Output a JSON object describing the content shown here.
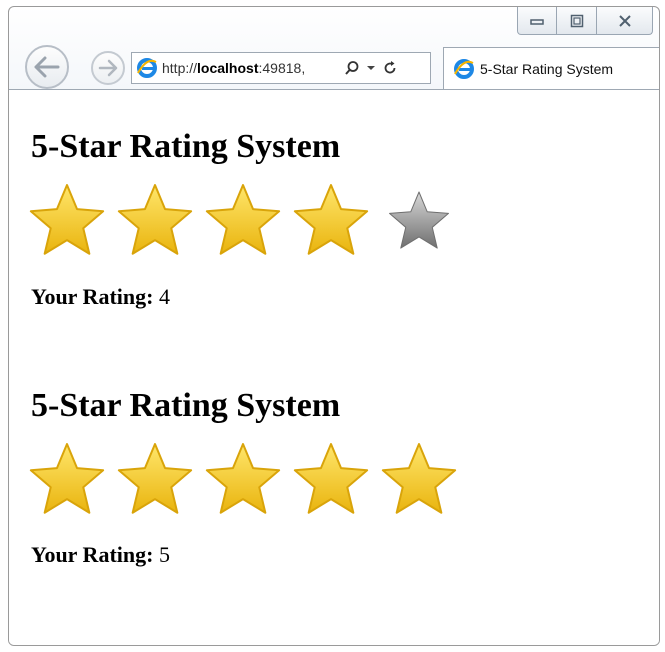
{
  "browser": {
    "address_prefix": "http://",
    "address_host": "localhost",
    "address_suffix": ":49818,",
    "tab_title": "5-Star Rating System"
  },
  "colors": {
    "star_on_top": "#ffe66b",
    "star_on_bottom": "#e9b40e",
    "star_on_stroke": "#d9a40a",
    "star_off_top": "#d8d8d8",
    "star_off_bottom": "#6f6f6f"
  },
  "widgets": [
    {
      "title": "5-Star Rating System",
      "rating_label": "Your Rating:",
      "rating_value": "4",
      "rating": 4,
      "max": 5
    },
    {
      "title": "5-Star Rating System",
      "rating_label": "Your Rating:",
      "rating_value": "5",
      "rating": 5,
      "max": 5
    }
  ]
}
